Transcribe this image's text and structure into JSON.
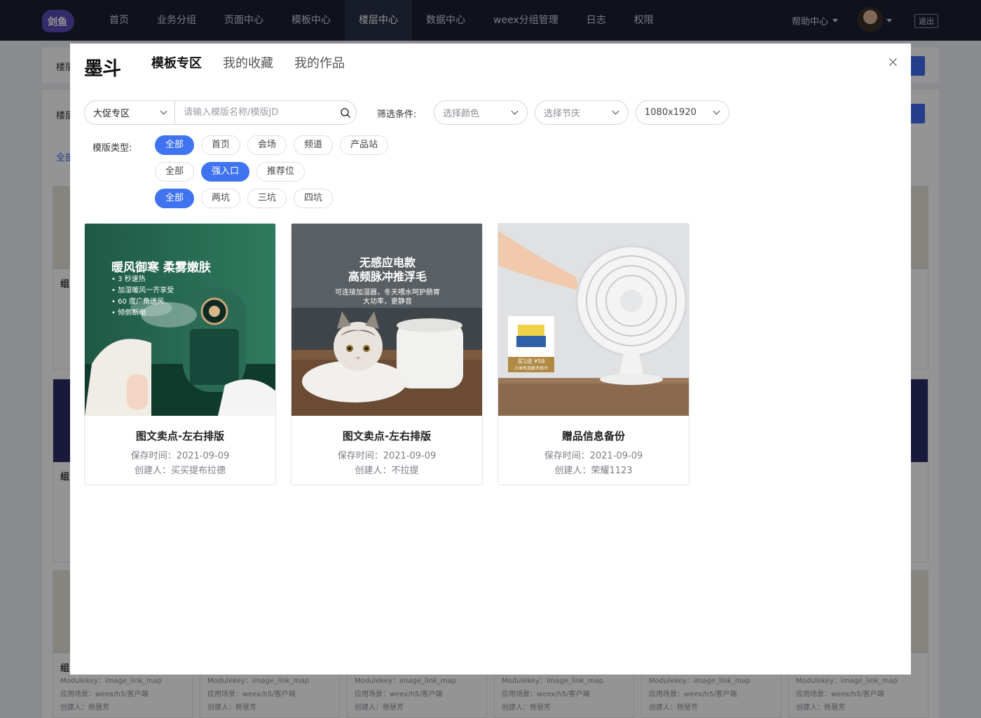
{
  "app": {
    "logo_text": "剑鱼",
    "nav": [
      "首页",
      "业务分组",
      "页面中心",
      "模板中心",
      "楼层中心",
      "数据中心",
      "weex分组管理",
      "日志",
      "权限"
    ],
    "active_nav": "楼层中心",
    "help": "帮助中心",
    "logout": "退出"
  },
  "background": {
    "row1_label": "楼层",
    "row2_label": "楼层",
    "tab_hint": "全部",
    "group_title": "组",
    "meta": {
      "modulekey": "Modulekey：image_link_map",
      "scene": "应用场景：weex/h5/客户端",
      "creator": "创建人：杨慧芳"
    }
  },
  "modal": {
    "brand": "墨斗",
    "tabs": [
      "模板专区",
      "我的收藏",
      "我的作品"
    ],
    "active_tab": "模板专区",
    "zone_select": "大促专区",
    "search_placeholder": "请输入模版名称/模版JD",
    "filter_label": "筛选条件:",
    "color_select": "选择颜色",
    "festival_select": "选择节庆",
    "size_select": "1080x1920",
    "type_label": "模版类型:",
    "type_rows": [
      {
        "chips": [
          "全部",
          "首页",
          "会场",
          "频道",
          "产品站"
        ],
        "active": "全部"
      },
      {
        "chips": [
          "全部",
          "强入口",
          "推荐位"
        ],
        "active": "强入口"
      },
      {
        "chips": [
          "全部",
          "两坑",
          "三坑",
          "四坑"
        ],
        "active": "全部"
      }
    ],
    "cards": [
      {
        "title": "图文卖点-左右排版",
        "saved": "保存时间：2021-09-09",
        "creator": "创建人：买买提布拉德",
        "headline": "暖风御寒 柔雾嫩肤",
        "bullets": [
          "3 秒速热",
          "加湿暖风一齐享受",
          "60 度广角送风",
          "倾倒断电"
        ]
      },
      {
        "title": "图文卖点-左右排版",
        "saved": "保存时间：2021-09-09",
        "creator": "创建人：不拉提",
        "headline1": "无感应电款",
        "headline2": "高频脉冲推浮毛",
        "sub1": "可连接加湿器，冬天喂水呵护肠胃",
        "sub2": "大功率，更静音"
      },
      {
        "title": "赠品信息备份",
        "saved": "保存时间：2021-09-09",
        "creator": "创建人：荣耀1123",
        "gift1": "买1送 ¥58",
        "gift2": "小米有品原木纸巾"
      }
    ]
  }
}
